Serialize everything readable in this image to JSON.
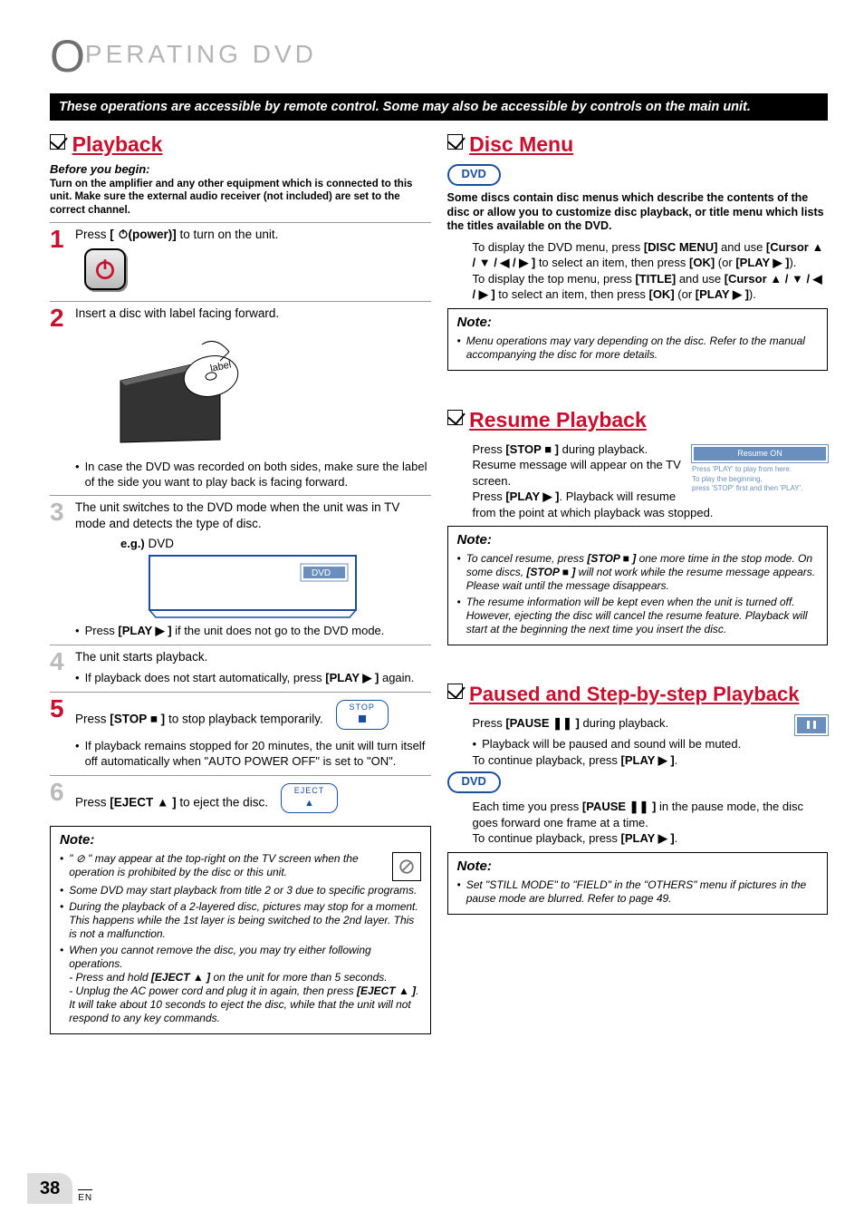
{
  "chapter": {
    "prefix": "O",
    "rest": "PERATING  DVD"
  },
  "blackBar": "These operations are accessible by remote control. Some may also be accessible by controls on the main unit.",
  "left": {
    "playback": {
      "title": "Playback",
      "before": "Before you begin:",
      "intro": "Turn on the amplifier and any other equipment which is connected to this unit. Make sure the external audio receiver (not included) are set to the correct channel.",
      "step1": {
        "a": "Press ",
        "b": "[ ",
        "c": "(power)]",
        "d": " to turn on the unit."
      },
      "step2": {
        "text": "Insert a disc with label facing forward.",
        "label": "label",
        "bullet": "In case the DVD was recorded on both sides, make sure the label of the side you want to play back is facing forward."
      },
      "step3": {
        "text": "The unit switches to the DVD mode when the unit was in TV mode and detects the type of disc.",
        "eg": "e.g.)",
        "egval": " DVD",
        "osd": "DVD",
        "bullet_a": "Press ",
        "bullet_b": "[PLAY ▶ ]",
        "bullet_c": " if the unit does not go to the DVD mode."
      },
      "step4": {
        "text": "The unit starts playback.",
        "bullet_a": "If playback does not start automatically, press ",
        "bullet_b": "[PLAY ▶ ]",
        "bullet_c": " again."
      },
      "step5": {
        "a": "Press ",
        "b": "[STOP ■ ]",
        "c": " to stop playback temporarily.",
        "btnLabel": "STOP",
        "bullet": "If playback remains stopped for 20 minutes, the unit will turn itself off automatically when \"AUTO POWER OFF\" is set to \"ON\"."
      },
      "step6": {
        "a": "Press ",
        "b": "[EJECT ▲ ]",
        "c": " to eject the disc.",
        "btnLabel": "EJECT"
      },
      "note": {
        "label": "Note:",
        "i1": "\" ⊘ \" may appear at the top-right on the TV screen when the operation is prohibited by the disc or this unit.",
        "i2": "Some DVD may start playback from title 2 or 3 due to specific programs.",
        "i3": "During the playback of a 2-layered disc, pictures may stop for a moment. This happens while the 1st layer is being switched to the 2nd layer. This is not a malfunction.",
        "i4": "When you cannot remove the disc, you may try either following operations.",
        "i4a_a": "- Press and hold ",
        "i4a_b": "[EJECT ▲ ]",
        "i4a_c": " on the unit for more than 5 seconds.",
        "i4b_a": "- Unplug the AC power cord and plug it in again, then press ",
        "i4b_b": "[EJECT ▲ ]",
        "i4b_c": ".",
        "i4c": "It will take about 10 seconds to eject the disc, while that the unit will not respond to any key commands."
      }
    }
  },
  "right": {
    "discMenu": {
      "title": "Disc Menu",
      "pill": "DVD",
      "intro": "Some discs contain disc menus which describe the contents of the disc or allow you to customize disc playback, or title menu which lists the titles available on the DVD.",
      "p1_a": "To display the DVD menu, press ",
      "p1_b": "[DISC MENU]",
      "p1_c": " and use ",
      "p1_cur": "[Cursor ▲ / ▼ / ◀ / ▶ ]",
      "p1_d": " to select an item, then press ",
      "p1_ok": "[OK]",
      "p1_e": " (or ",
      "p1_play": "[PLAY ▶ ]",
      "p1_f": ").",
      "p2_a": "To display the top menu, press ",
      "p2_b": "[TITLE]",
      "p2_c": " and use ",
      "p2_cur": "[Cursor ▲ / ▼ / ◀ / ▶ ]",
      "p2_d": " to select an item, then press ",
      "p2_ok": "[OK]",
      "p2_e": " (or ",
      "p2_play": "[PLAY ▶ ]",
      "p2_f": ").",
      "note": {
        "label": "Note:",
        "i1": "Menu operations may vary depending on the disc. Refer to the manual accompanying the disc for more details."
      }
    },
    "resume": {
      "title": "Resume Playback",
      "p_a": "Press ",
      "p_b": "[STOP ■ ]",
      "p_c": " during playback. Resume message will appear on the TV screen.",
      "p2_a": "Press ",
      "p2_b": "[PLAY ▶ ]",
      "p2_c": ". Playback will resume from the point at which playback was stopped.",
      "osd": {
        "title": "Resume ON",
        "line1": "Press 'PLAY' to play from here.",
        "line2": "To play the beginning,",
        "line3": "press 'STOP' first and then 'PLAY'."
      },
      "note": {
        "label": "Note:",
        "i1_a": "To cancel resume, press ",
        "i1_b": "[STOP ■ ]",
        "i1_c": " one more time in the stop mode. On some discs, ",
        "i1_d": "[STOP ■ ]",
        "i1_e": " will not work while the resume message appears. Please wait until the message disappears.",
        "i2": "The resume information will be kept even when the unit is turned off. However, ejecting the disc will cancel the resume feature. Playback will start at the beginning the next time you insert the disc."
      }
    },
    "pause": {
      "title": "Paused and Step-by-step Playback",
      "p_a": "Press ",
      "p_b": "[PAUSE ❚❚ ]",
      "p_c": " during playback.",
      "b1": "Playback will be paused and sound will be muted.",
      "p2_a": "To continue playback, press ",
      "p2_b": "[PLAY ▶ ]",
      "p2_c": ".",
      "pill": "DVD",
      "p3_a": "Each time you press ",
      "p3_b": "[PAUSE ❚❚ ]",
      "p3_c": " in the pause mode, the disc goes forward one frame at a time.",
      "p4_a": "To continue playback, press ",
      "p4_b": "[PLAY ▶ ]",
      "p4_c": ".",
      "note": {
        "label": "Note:",
        "i1": "Set \"STILL MODE\" to \"FIELD\" in the \"OTHERS\" menu if pictures in the pause mode are blurred. Refer to page 49."
      }
    }
  },
  "footer": {
    "page": "38",
    "lang": "EN"
  }
}
